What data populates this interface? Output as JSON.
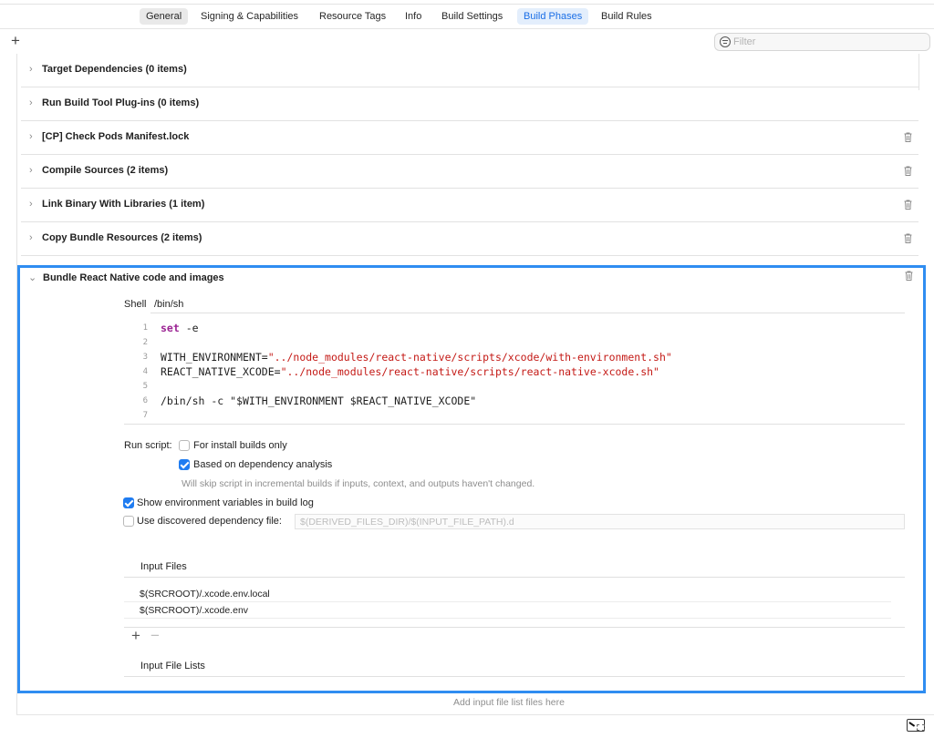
{
  "tabs": [
    {
      "label": "General",
      "state": "grey"
    },
    {
      "label": "Signing & Capabilities",
      "state": ""
    },
    {
      "label": "Resource Tags",
      "state": ""
    },
    {
      "label": "Info",
      "state": ""
    },
    {
      "label": "Build Settings",
      "state": ""
    },
    {
      "label": "Build Phases",
      "state": "selected"
    },
    {
      "label": "Build Rules",
      "state": ""
    }
  ],
  "toolbar": {
    "add_label": "+",
    "filter_placeholder": "Filter"
  },
  "phases": [
    {
      "title": "Target Dependencies (0 items)",
      "deletable": false
    },
    {
      "title": "Run Build Tool Plug-ins (0 items)",
      "deletable": false
    },
    {
      "title": "[CP] Check Pods Manifest.lock",
      "deletable": true
    },
    {
      "title": "Compile Sources (2 items)",
      "deletable": true
    },
    {
      "title": "Link Binary With Libraries (1 item)",
      "deletable": true
    },
    {
      "title": "Copy Bundle Resources (2 items)",
      "deletable": true
    }
  ],
  "script_phase": {
    "title": "Bundle React Native code and images",
    "shell_label": "Shell",
    "shell_value": "/bin/sh",
    "code_lines": [
      {
        "n": "1",
        "parts": [
          {
            "t": "set",
            "c": "kw"
          },
          {
            "t": " -e",
            "c": ""
          }
        ]
      },
      {
        "n": "2",
        "parts": []
      },
      {
        "n": "3",
        "parts": [
          {
            "t": "WITH_ENVIRONMENT=",
            "c": ""
          },
          {
            "t": "\"../node_modules/react-native/scripts/xcode/with-environment.sh\"",
            "c": "str"
          }
        ]
      },
      {
        "n": "4",
        "parts": [
          {
            "t": "REACT_NATIVE_XCODE=",
            "c": ""
          },
          {
            "t": "\"../node_modules/react-native/scripts/react-native-xcode.sh\"",
            "c": "str"
          }
        ]
      },
      {
        "n": "5",
        "parts": []
      },
      {
        "n": "6",
        "parts": [
          {
            "t": "/bin/sh -c \"$WITH_ENVIRONMENT $REACT_NATIVE_XCODE\"",
            "c": ""
          }
        ]
      },
      {
        "n": "7",
        "parts": []
      }
    ],
    "run_script_label": "Run script:",
    "install_builds_label": "For install builds only",
    "install_builds_checked": false,
    "dependency_analysis_label": "Based on dependency analysis",
    "dependency_analysis_checked": true,
    "dependency_hint": "Will skip script in incremental builds if inputs, context, and outputs haven't changed.",
    "show_env_label": "Show environment variables in build log",
    "show_env_checked": true,
    "discovered_dep_label": "Use discovered dependency file:",
    "discovered_dep_checked": false,
    "discovered_dep_placeholder": "$(DERIVED_FILES_DIR)/$(INPUT_FILE_PATH).d",
    "input_files_header": "Input Files",
    "input_files": [
      "$(SRCROOT)/.xcode.env.local",
      "$(SRCROOT)/.xcode.env"
    ],
    "add_item_label": "+",
    "remove_item_label": "−",
    "input_file_lists_header": "Input File Lists",
    "input_file_lists_hint": "Add input file list files here"
  }
}
